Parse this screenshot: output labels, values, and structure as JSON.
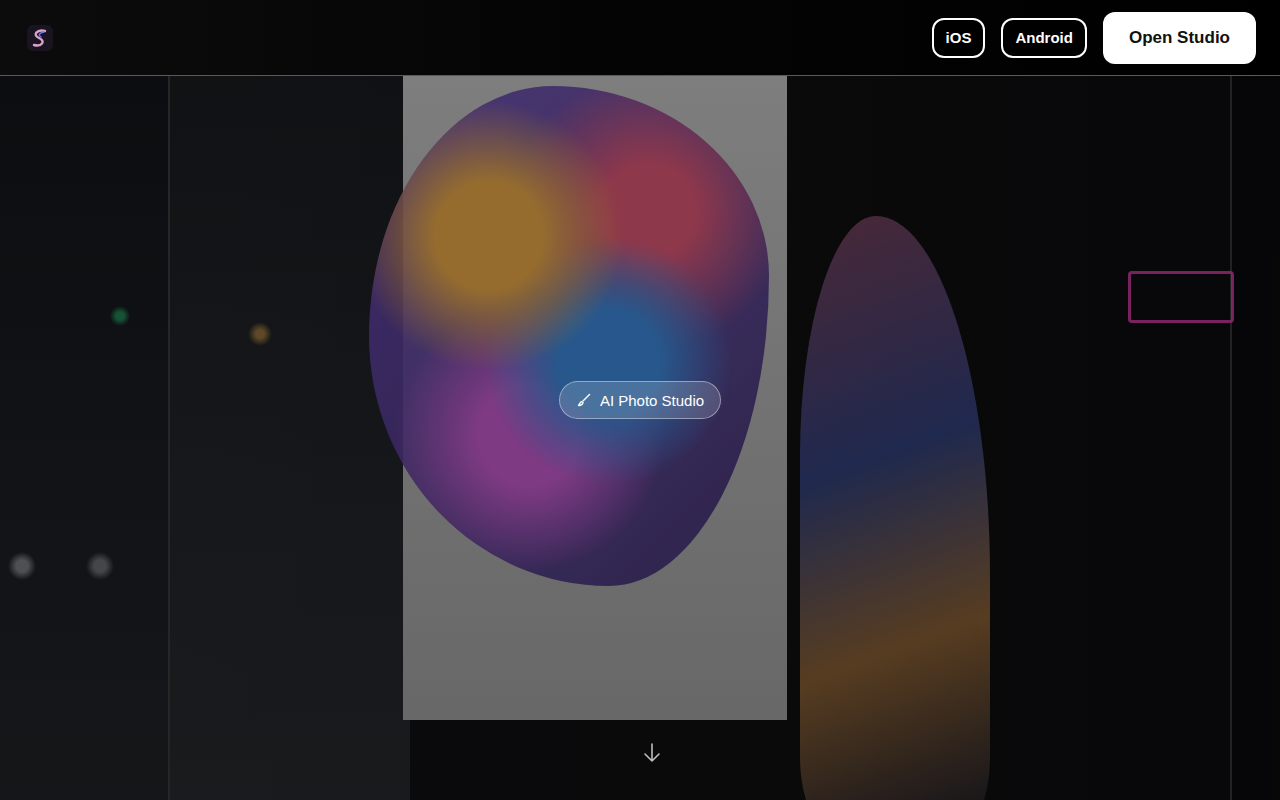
{
  "header": {
    "buttons": [
      {
        "label": "iOS",
        "kind": "outline"
      },
      {
        "label": "Android",
        "kind": "outline"
      },
      {
        "label": "Open Studio",
        "kind": "primary"
      }
    ]
  },
  "hero": {
    "badge": {
      "label": "AI Photo Studio"
    }
  }
}
